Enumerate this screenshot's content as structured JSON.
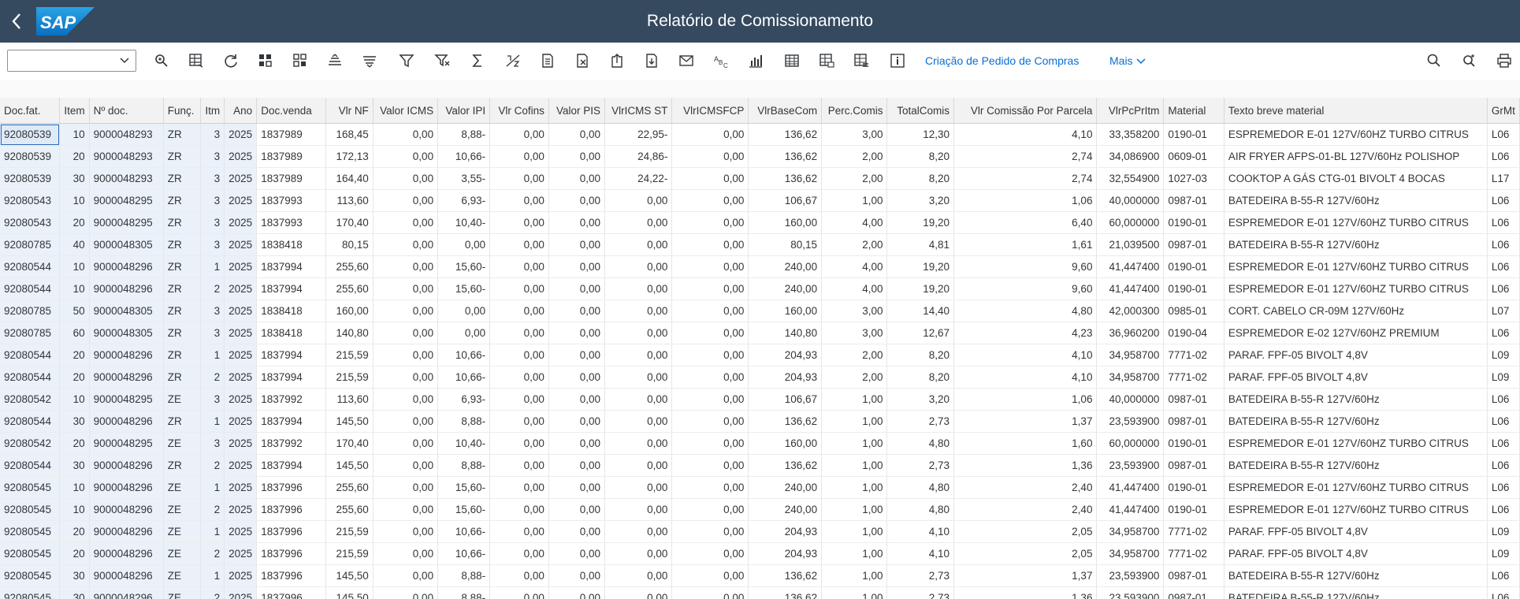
{
  "header": {
    "title": "Relatório de Comissionamento",
    "logo_text": "SAP"
  },
  "toolbar": {
    "variant_value": "",
    "icons": [
      "find-icon",
      "column-layout-icon",
      "refresh-icon",
      "grid-icon",
      "grid-alt-icon",
      "sort-ascending-icon",
      "sort-descending-icon",
      "filter-icon",
      "filter-remove-icon",
      "sum-icon",
      "subtotal-icon",
      "document-icon",
      "delete-document-icon",
      "export-icon",
      "import-icon",
      "mail-icon",
      "abc-analysis-icon",
      "chart-icon",
      "table-icon",
      "layout-icon",
      "layout-alt-icon",
      "info-icon"
    ],
    "action_label": "Criação de Pedido de Compras",
    "more_label": "Mais",
    "right_icons": [
      "search-icon",
      "zoom-icon",
      "print-icon"
    ]
  },
  "table": {
    "columns": [
      "Doc.fat.",
      "Item",
      "Nº doc.",
      "Funç.",
      "Itm",
      "Ano",
      "Doc.venda",
      "Vlr NF",
      "Valor ICMS",
      "Valor IPI",
      "Vlr Cofins",
      "Valor PIS",
      "VlrICMS ST",
      "VlrICMSFCP",
      "VlrBaseCom",
      "Perc.Comis",
      "TotalComis",
      "Vlr Comissão Por Parcela",
      "VlrPcPrItm",
      "Material",
      "Texto breve material",
      "GrMt"
    ],
    "rows": [
      [
        "92080539",
        "10",
        "9000048293",
        "ZR",
        "3",
        "2025",
        "1837989",
        "168,45",
        "0,00",
        "8,88-",
        "0,00",
        "0,00",
        "22,95-",
        "0,00",
        "136,62",
        "3,00",
        "12,30",
        "4,10",
        "33,358200",
        "0190-01",
        "ESPREMEDOR E-01 127V/60HZ TURBO CITRUS",
        "L06"
      ],
      [
        "92080539",
        "20",
        "9000048293",
        "ZR",
        "3",
        "2025",
        "1837989",
        "172,13",
        "0,00",
        "10,66-",
        "0,00",
        "0,00",
        "24,86-",
        "0,00",
        "136,62",
        "2,00",
        "8,20",
        "2,74",
        "34,086900",
        "0609-01",
        "AIR FRYER AFPS-01-BL 127V/60Hz POLISHOP",
        "L06"
      ],
      [
        "92080539",
        "30",
        "9000048293",
        "ZR",
        "3",
        "2025",
        "1837989",
        "164,40",
        "0,00",
        "3,55-",
        "0,00",
        "0,00",
        "24,22-",
        "0,00",
        "136,62",
        "2,00",
        "8,20",
        "2,74",
        "32,554900",
        "1027-03",
        "COOKTOP A GÁS CTG-01 BIVOLT 4 BOCAS",
        "L17"
      ],
      [
        "92080543",
        "10",
        "9000048295",
        "ZR",
        "3",
        "2025",
        "1837993",
        "113,60",
        "0,00",
        "6,93-",
        "0,00",
        "0,00",
        "0,00",
        "0,00",
        "106,67",
        "1,00",
        "3,20",
        "1,06",
        "40,000000",
        "0987-01",
        "BATEDEIRA B-55-R 127V/60Hz",
        "L06"
      ],
      [
        "92080543",
        "20",
        "9000048295",
        "ZR",
        "3",
        "2025",
        "1837993",
        "170,40",
        "0,00",
        "10,40-",
        "0,00",
        "0,00",
        "0,00",
        "0,00",
        "160,00",
        "4,00",
        "19,20",
        "6,40",
        "60,000000",
        "0190-01",
        "ESPREMEDOR E-01 127V/60HZ TURBO CITRUS",
        "L06"
      ],
      [
        "92080785",
        "40",
        "9000048305",
        "ZR",
        "3",
        "2025",
        "1838418",
        "80,15",
        "0,00",
        "0,00",
        "0,00",
        "0,00",
        "0,00",
        "0,00",
        "80,15",
        "2,00",
        "4,81",
        "1,61",
        "21,039500",
        "0987-01",
        "BATEDEIRA B-55-R 127V/60Hz",
        "L06"
      ],
      [
        "92080544",
        "10",
        "9000048296",
        "ZR",
        "1",
        "2025",
        "1837994",
        "255,60",
        "0,00",
        "15,60-",
        "0,00",
        "0,00",
        "0,00",
        "0,00",
        "240,00",
        "4,00",
        "19,20",
        "9,60",
        "41,447400",
        "0190-01",
        "ESPREMEDOR E-01 127V/60HZ TURBO CITRUS",
        "L06"
      ],
      [
        "92080544",
        "10",
        "9000048296",
        "ZR",
        "2",
        "2025",
        "1837994",
        "255,60",
        "0,00",
        "15,60-",
        "0,00",
        "0,00",
        "0,00",
        "0,00",
        "240,00",
        "4,00",
        "19,20",
        "9,60",
        "41,447400",
        "0190-01",
        "ESPREMEDOR E-01 127V/60HZ TURBO CITRUS",
        "L06"
      ],
      [
        "92080785",
        "50",
        "9000048305",
        "ZR",
        "3",
        "2025",
        "1838418",
        "160,00",
        "0,00",
        "0,00",
        "0,00",
        "0,00",
        "0,00",
        "0,00",
        "160,00",
        "3,00",
        "14,40",
        "4,80",
        "42,000300",
        "0985-01",
        "CORT. CABELO CR-09M 127V/60Hz",
        "L07"
      ],
      [
        "92080785",
        "60",
        "9000048305",
        "ZR",
        "3",
        "2025",
        "1838418",
        "140,80",
        "0,00",
        "0,00",
        "0,00",
        "0,00",
        "0,00",
        "0,00",
        "140,80",
        "3,00",
        "12,67",
        "4,23",
        "36,960200",
        "0190-04",
        "ESPREMEDOR E-02 127V/60HZ PREMIUM",
        "L06"
      ],
      [
        "92080544",
        "20",
        "9000048296",
        "ZR",
        "1",
        "2025",
        "1837994",
        "215,59",
        "0,00",
        "10,66-",
        "0,00",
        "0,00",
        "0,00",
        "0,00",
        "204,93",
        "2,00",
        "8,20",
        "4,10",
        "34,958700",
        "7771-02",
        "PARAF. FPF-05 BIVOLT 4,8V",
        "L09"
      ],
      [
        "92080544",
        "20",
        "9000048296",
        "ZR",
        "2",
        "2025",
        "1837994",
        "215,59",
        "0,00",
        "10,66-",
        "0,00",
        "0,00",
        "0,00",
        "0,00",
        "204,93",
        "2,00",
        "8,20",
        "4,10",
        "34,958700",
        "7771-02",
        "PARAF. FPF-05 BIVOLT 4,8V",
        "L09"
      ],
      [
        "92080542",
        "10",
        "9000048295",
        "ZE",
        "3",
        "2025",
        "1837992",
        "113,60",
        "0,00",
        "6,93-",
        "0,00",
        "0,00",
        "0,00",
        "0,00",
        "106,67",
        "1,00",
        "3,20",
        "1,06",
        "40,000000",
        "0987-01",
        "BATEDEIRA B-55-R 127V/60Hz",
        "L06"
      ],
      [
        "92080544",
        "30",
        "9000048296",
        "ZR",
        "1",
        "2025",
        "1837994",
        "145,50",
        "0,00",
        "8,88-",
        "0,00",
        "0,00",
        "0,00",
        "0,00",
        "136,62",
        "1,00",
        "2,73",
        "1,37",
        "23,593900",
        "0987-01",
        "BATEDEIRA B-55-R 127V/60Hz",
        "L06"
      ],
      [
        "92080542",
        "20",
        "9000048295",
        "ZE",
        "3",
        "2025",
        "1837992",
        "170,40",
        "0,00",
        "10,40-",
        "0,00",
        "0,00",
        "0,00",
        "0,00",
        "160,00",
        "1,00",
        "4,80",
        "1,60",
        "60,000000",
        "0190-01",
        "ESPREMEDOR E-01 127V/60HZ TURBO CITRUS",
        "L06"
      ],
      [
        "92080544",
        "30",
        "9000048296",
        "ZR",
        "2",
        "2025",
        "1837994",
        "145,50",
        "0,00",
        "8,88-",
        "0,00",
        "0,00",
        "0,00",
        "0,00",
        "136,62",
        "1,00",
        "2,73",
        "1,36",
        "23,593900",
        "0987-01",
        "BATEDEIRA B-55-R 127V/60Hz",
        "L06"
      ],
      [
        "92080545",
        "10",
        "9000048296",
        "ZE",
        "1",
        "2025",
        "1837996",
        "255,60",
        "0,00",
        "15,60-",
        "0,00",
        "0,00",
        "0,00",
        "0,00",
        "240,00",
        "1,00",
        "4,80",
        "2,40",
        "41,447400",
        "0190-01",
        "ESPREMEDOR E-01 127V/60HZ TURBO CITRUS",
        "L06"
      ],
      [
        "92080545",
        "10",
        "9000048296",
        "ZE",
        "2",
        "2025",
        "1837996",
        "255,60",
        "0,00",
        "15,60-",
        "0,00",
        "0,00",
        "0,00",
        "0,00",
        "240,00",
        "1,00",
        "4,80",
        "2,40",
        "41,447400",
        "0190-01",
        "ESPREMEDOR E-01 127V/60HZ TURBO CITRUS",
        "L06"
      ],
      [
        "92080545",
        "20",
        "9000048296",
        "ZE",
        "1",
        "2025",
        "1837996",
        "215,59",
        "0,00",
        "10,66-",
        "0,00",
        "0,00",
        "0,00",
        "0,00",
        "204,93",
        "1,00",
        "4,10",
        "2,05",
        "34,958700",
        "7771-02",
        "PARAF. FPF-05 BIVOLT 4,8V",
        "L09"
      ],
      [
        "92080545",
        "20",
        "9000048296",
        "ZE",
        "2",
        "2025",
        "1837996",
        "215,59",
        "0,00",
        "10,66-",
        "0,00",
        "0,00",
        "0,00",
        "0,00",
        "204,93",
        "1,00",
        "4,10",
        "2,05",
        "34,958700",
        "7771-02",
        "PARAF. FPF-05 BIVOLT 4,8V",
        "L09"
      ],
      [
        "92080545",
        "30",
        "9000048296",
        "ZE",
        "1",
        "2025",
        "1837996",
        "145,50",
        "0,00",
        "8,88-",
        "0,00",
        "0,00",
        "0,00",
        "0,00",
        "136,62",
        "1,00",
        "2,73",
        "1,37",
        "23,593900",
        "0987-01",
        "BATEDEIRA B-55-R 127V/60Hz",
        "L06"
      ],
      [
        "92080545",
        "30",
        "9000048296",
        "ZE",
        "2",
        "2025",
        "1837996",
        "145,50",
        "0,00",
        "8,88-",
        "0,00",
        "0,00",
        "0,00",
        "0,00",
        "136,62",
        "1,00",
        "2,73",
        "1,36",
        "23,593900",
        "0987-01",
        "BATEDEIRA B-55-R 127V/60Hz",
        "L06"
      ]
    ]
  },
  "colors": {
    "header_bg": "#354a5f",
    "link": "#0a6ed1",
    "key_col_bg": "#eaf1f9",
    "text": "#32363a"
  }
}
